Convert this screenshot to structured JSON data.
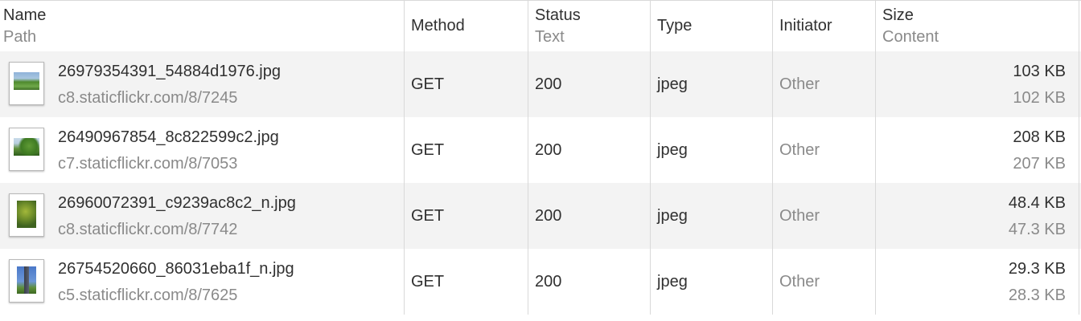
{
  "columns": {
    "name": {
      "primary": "Name",
      "secondary": "Path"
    },
    "method": {
      "primary": "Method"
    },
    "status": {
      "primary": "Status",
      "secondary": "Text"
    },
    "type": {
      "primary": "Type"
    },
    "initiator": {
      "primary": "Initiator"
    },
    "size": {
      "primary": "Size",
      "secondary": "Content"
    }
  },
  "rows": [
    {
      "name": "26979354391_54884d1976.jpg",
      "path": "c8.staticflickr.com/8/7245",
      "method": "GET",
      "status": "200",
      "type": "jpeg",
      "initiator": "Other",
      "size": "103 KB",
      "content": "102 KB",
      "thumbnail_icon": "landscape-photo-thumbnail-icon"
    },
    {
      "name": "26490967854_8c822599c2.jpg",
      "path": "c7.staticflickr.com/8/7053",
      "method": "GET",
      "status": "200",
      "type": "jpeg",
      "initiator": "Other",
      "size": "208 KB",
      "content": "207 KB",
      "thumbnail_icon": "landscape-photo-thumbnail-icon"
    },
    {
      "name": "26960072391_c9239ac8c2_n.jpg",
      "path": "c8.staticflickr.com/8/7742",
      "method": "GET",
      "status": "200",
      "type": "jpeg",
      "initiator": "Other",
      "size": "48.4 KB",
      "content": "47.3 KB",
      "thumbnail_icon": "portrait-photo-thumbnail-icon"
    },
    {
      "name": "26754520660_86031eba1f_n.jpg",
      "path": "c5.staticflickr.com/8/7625",
      "method": "GET",
      "status": "200",
      "type": "jpeg",
      "initiator": "Other",
      "size": "29.3 KB",
      "content": "28.3 KB",
      "thumbnail_icon": "portrait-photo-thumbnail-icon"
    }
  ],
  "colors": {
    "row_alt_background": "#f3f3f3",
    "grid_line": "#d9d9d9",
    "primary_text": "#303030",
    "secondary_text": "#8a8a8a"
  }
}
